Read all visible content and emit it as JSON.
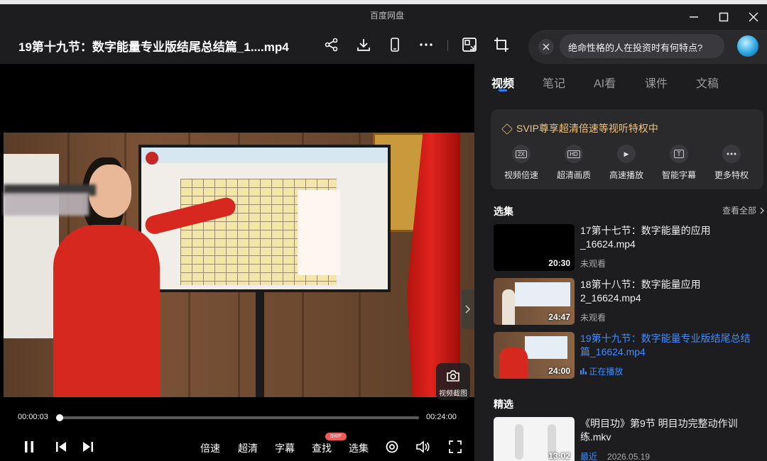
{
  "app": {
    "title": "百度网盘"
  },
  "header": {
    "file_title": "19第十九节：数字能量专业版结尾总结篇_1....mp4",
    "search_text": "绝命性格的人在投资时有何特点?"
  },
  "player": {
    "current_time": "00:00:03",
    "total_time": "00:24:00",
    "progress": 0.002,
    "snapshot_label": "视频截图",
    "controls": {
      "speed": "倍速",
      "quality": "超清",
      "subtitle": "字幕",
      "find": "查找",
      "find_badge": "SWP",
      "episodes": "选集"
    }
  },
  "sidebar": {
    "tabs": [
      "视频",
      "笔记",
      "AI看",
      "课件",
      "文稿"
    ],
    "svip": {
      "title": "SVIP尊享超清倍速等视听特权中",
      "items": [
        "视频倍速",
        "超清画质",
        "高速播放",
        "智能字幕",
        "更多特权"
      ],
      "icon_texts": [
        "2X",
        "HD",
        "▶",
        "T"
      ]
    },
    "episodes_heading": "选集",
    "see_all": "查看全部",
    "episodes": [
      {
        "title": "17第十七节：数字能量的应用_16624.mp4",
        "duration": "20:30",
        "status": "未观看"
      },
      {
        "title": "18第十八节：数字能量应用2_16624.mp4",
        "duration": "24:47",
        "status": "未观看"
      },
      {
        "title": "19第十九节：数字能量专业版结尾总结篇_16624.mp4",
        "duration": "24:00",
        "status": "正在播放"
      }
    ],
    "featured_heading": "精选",
    "featured": [
      {
        "title": "《明目功》第9节 明目功完整动作训练.mkv",
        "duration": "13:02",
        "tag": "最近",
        "date": "2026.05.19"
      }
    ]
  },
  "colors": {
    "accent": "#3e8cff",
    "svip_gold": "#efc37c",
    "red_dress": "#d6281f"
  }
}
